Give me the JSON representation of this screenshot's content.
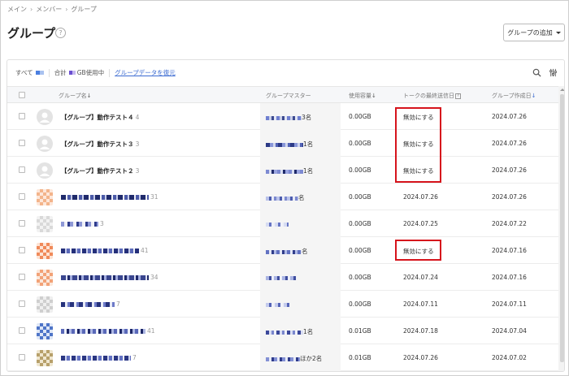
{
  "breadcrumb": {
    "items": [
      "メイン",
      "メンバー",
      "グループ"
    ]
  },
  "page": {
    "title": "グループ",
    "help": "?"
  },
  "toolbar": {
    "add_group_label": "グループの追加"
  },
  "summary": {
    "all_label": "すべて",
    "total_label": "合計",
    "usage_label": "GB使用中",
    "restore_link": "グループデータを復元"
  },
  "table": {
    "headers": {
      "name": "グループ名",
      "master": "グループマスター",
      "usage": "使用容量",
      "last_sent": "トークの最終送信日",
      "created": "グループ作成日"
    },
    "sort_arrow": "↓",
    "help_mark": "?",
    "rows": [
      {
        "name": "【グループ】動作テスト４",
        "count": "4",
        "master_suffix": "3名",
        "usage": "0.00GB",
        "last_sent": "無効にする",
        "created": "2024.07.26"
      },
      {
        "name": "【グループ】動作テスト３",
        "count": "3",
        "master_suffix": "1名",
        "usage": "0.00GB",
        "last_sent": "無効にする",
        "created": "2024.07.26"
      },
      {
        "name": "【グループ】動作テスト２",
        "count": "3",
        "master_suffix": "1名",
        "usage": "0.00GB",
        "last_sent": "無効にする",
        "created": "2024.07.26"
      },
      {
        "name": "",
        "count": "31",
        "master_suffix": "名",
        "usage": "0.00GB",
        "last_sent": "2024.07.26",
        "created": "2024.07.26"
      },
      {
        "name": "",
        "count": "3",
        "master_suffix": "",
        "usage": "0.00GB",
        "last_sent": "2024.07.25",
        "created": "2024.07.22"
      },
      {
        "name": "",
        "count": "41",
        "master_suffix": "名",
        "usage": "0.00GB",
        "last_sent": "無効にする",
        "created": "2024.07.16"
      },
      {
        "name": "",
        "count": "34",
        "master_suffix": "",
        "usage": "0.00GB",
        "last_sent": "2024.07.24",
        "created": "2024.07.16"
      },
      {
        "name": "",
        "count": "7",
        "master_suffix": "",
        "usage": "0.00GB",
        "last_sent": "2024.07.11",
        "created": "2024.07.11"
      },
      {
        "name": "",
        "count": "41",
        "master_suffix": "1名",
        "usage": "0.01GB",
        "last_sent": "2024.07.18",
        "created": "2024.07.04"
      },
      {
        "name": "",
        "count": "7",
        "master_suffix": "ほか2名",
        "usage": "0.01GB",
        "last_sent": "2024.07.26",
        "created": "2024.07.02"
      }
    ]
  },
  "colors": {
    "accent": "#3a6ad1",
    "highlight": "#d6141c"
  }
}
